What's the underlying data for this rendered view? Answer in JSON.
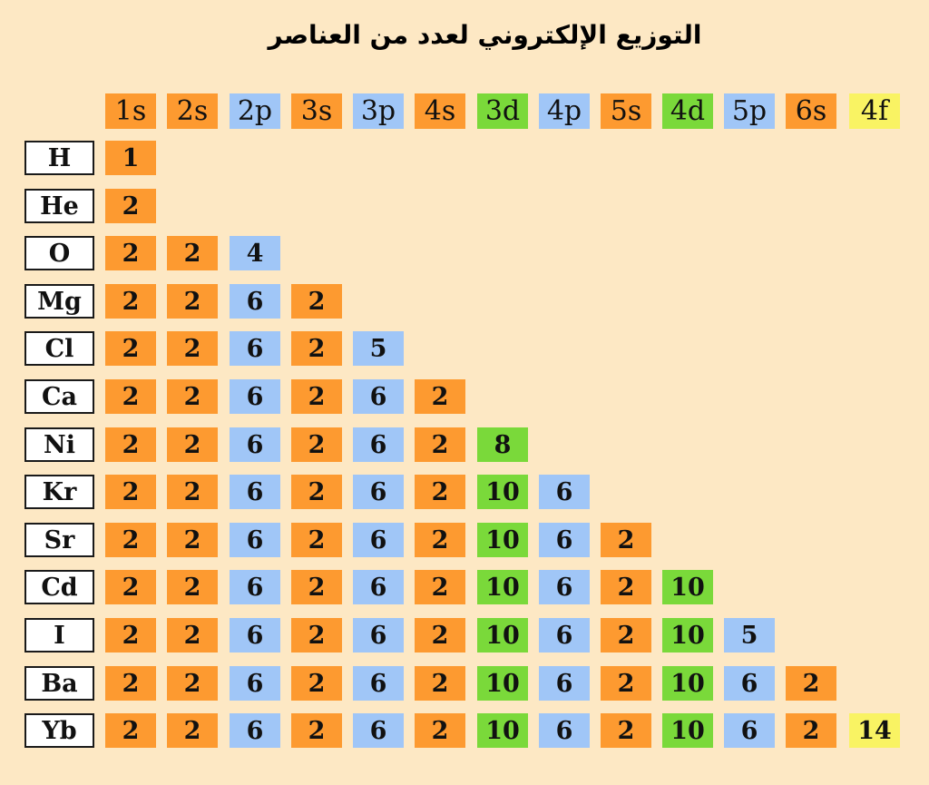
{
  "title": "التوزيع الإلكتروني لعدد من العناصر",
  "colors": {
    "background": "#fde8c4",
    "s": "#fd9a30",
    "p": "#a0c6f7",
    "d": "#7ad93a",
    "f": "#f9f363"
  },
  "orbitals": [
    {
      "label": "1s",
      "type": "s"
    },
    {
      "label": "2s",
      "type": "s"
    },
    {
      "label": "2p",
      "type": "p"
    },
    {
      "label": "3s",
      "type": "s"
    },
    {
      "label": "3p",
      "type": "p"
    },
    {
      "label": "4s",
      "type": "s"
    },
    {
      "label": "3d",
      "type": "d"
    },
    {
      "label": "4p",
      "type": "p"
    },
    {
      "label": "5s",
      "type": "s"
    },
    {
      "label": "4d",
      "type": "d"
    },
    {
      "label": "5p",
      "type": "p"
    },
    {
      "label": "6s",
      "type": "s"
    },
    {
      "label": "4f",
      "type": "f"
    }
  ],
  "elements": [
    {
      "symbol": "H",
      "electrons": [
        "1"
      ]
    },
    {
      "symbol": "He",
      "electrons": [
        "2"
      ]
    },
    {
      "symbol": "O",
      "electrons": [
        "2",
        "2",
        "4"
      ]
    },
    {
      "symbol": "Mg",
      "electrons": [
        "2",
        "2",
        "6",
        "2"
      ]
    },
    {
      "symbol": "Cl",
      "electrons": [
        "2",
        "2",
        "6",
        "2",
        "5"
      ]
    },
    {
      "symbol": "Ca",
      "electrons": [
        "2",
        "2",
        "6",
        "2",
        "6",
        "2"
      ]
    },
    {
      "symbol": "Ni",
      "electrons": [
        "2",
        "2",
        "6",
        "2",
        "6",
        "2",
        "8"
      ]
    },
    {
      "symbol": "Kr",
      "electrons": [
        "2",
        "2",
        "6",
        "2",
        "6",
        "2",
        "10",
        "6"
      ]
    },
    {
      "symbol": "Sr",
      "electrons": [
        "2",
        "2",
        "6",
        "2",
        "6",
        "2",
        "10",
        "6",
        "2"
      ]
    },
    {
      "symbol": "Cd",
      "electrons": [
        "2",
        "2",
        "6",
        "2",
        "6",
        "2",
        "10",
        "6",
        "2",
        "10"
      ]
    },
    {
      "symbol": "I",
      "electrons": [
        "2",
        "2",
        "6",
        "2",
        "6",
        "2",
        "10",
        "6",
        "2",
        "10",
        "5"
      ]
    },
    {
      "symbol": "Ba",
      "electrons": [
        "2",
        "2",
        "6",
        "2",
        "6",
        "2",
        "10",
        "6",
        "2",
        "10",
        "6",
        "2"
      ]
    },
    {
      "symbol": "Yb",
      "electrons": [
        "2",
        "2",
        "6",
        "2",
        "6",
        "2",
        "10",
        "6",
        "2",
        "10",
        "6",
        "2",
        "14"
      ]
    }
  ]
}
